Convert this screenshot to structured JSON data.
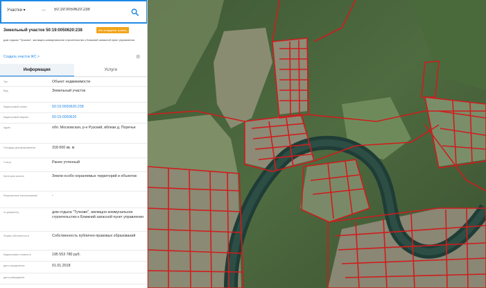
{
  "search": {
    "type_label": "Участки",
    "type_arrow": "▾",
    "separator": "—",
    "query": "50:19:0050620:238"
  },
  "parcel": {
    "title": "Земельный участок 50:19:0050620:238",
    "badge": "Без координат границ",
    "address": "дом отдыха \"Тучково\", жилищно-коммунальное строительство к Ближний запасной пункт управления",
    "address_prefix": "обл. Московская, р-н Рузский, вблизи д. Поречье",
    "create_link": "Создать участок ЖС >"
  },
  "tabs": [
    {
      "label": "Информация"
    },
    {
      "label": "Услуги"
    }
  ],
  "rows": [
    {
      "label": "Тип",
      "value": "Объект недвижимости"
    },
    {
      "label": "Вид",
      "value": "Земельный участок"
    },
    {
      "label": "Кадастровый номер",
      "value": "50:19:0050620:238"
    },
    {
      "label": "Кадастровый квартал",
      "value": "50:19:0050620"
    },
    {
      "label": "Адрес",
      "value": "обл. Московская, р-н Рузский, вблизи д. Поречье"
    },
    {
      "label": "Площадь декларированная",
      "value": "318 000 кв. м"
    },
    {
      "label": "Статус",
      "value": "Ранее учтенный"
    },
    {
      "label": "Категория земель",
      "value": "Земли особо охраняемых территорий и объектов"
    },
    {
      "label": "Разрешенное использование",
      "value": "-"
    },
    {
      "label": "по документу",
      "value": "дом отдыха \"Тучково\", жилищно-коммунальное строительство к Ближний запасной пункт управления"
    },
    {
      "label": "Форма собственности",
      "value": "Собственность публично-правовых образований"
    },
    {
      "label": "Кадастровая стоимость",
      "value": "195 553 780 руб."
    },
    {
      "label": "дата определения",
      "value": "01.01.2018"
    },
    {
      "label": "дата утверждения",
      "value": ""
    }
  ],
  "colors": {
    "accent": "#1e88e5",
    "badge": "#f2a51a",
    "parcel_outline": "#d01c1c",
    "river": "#1f3d36"
  }
}
